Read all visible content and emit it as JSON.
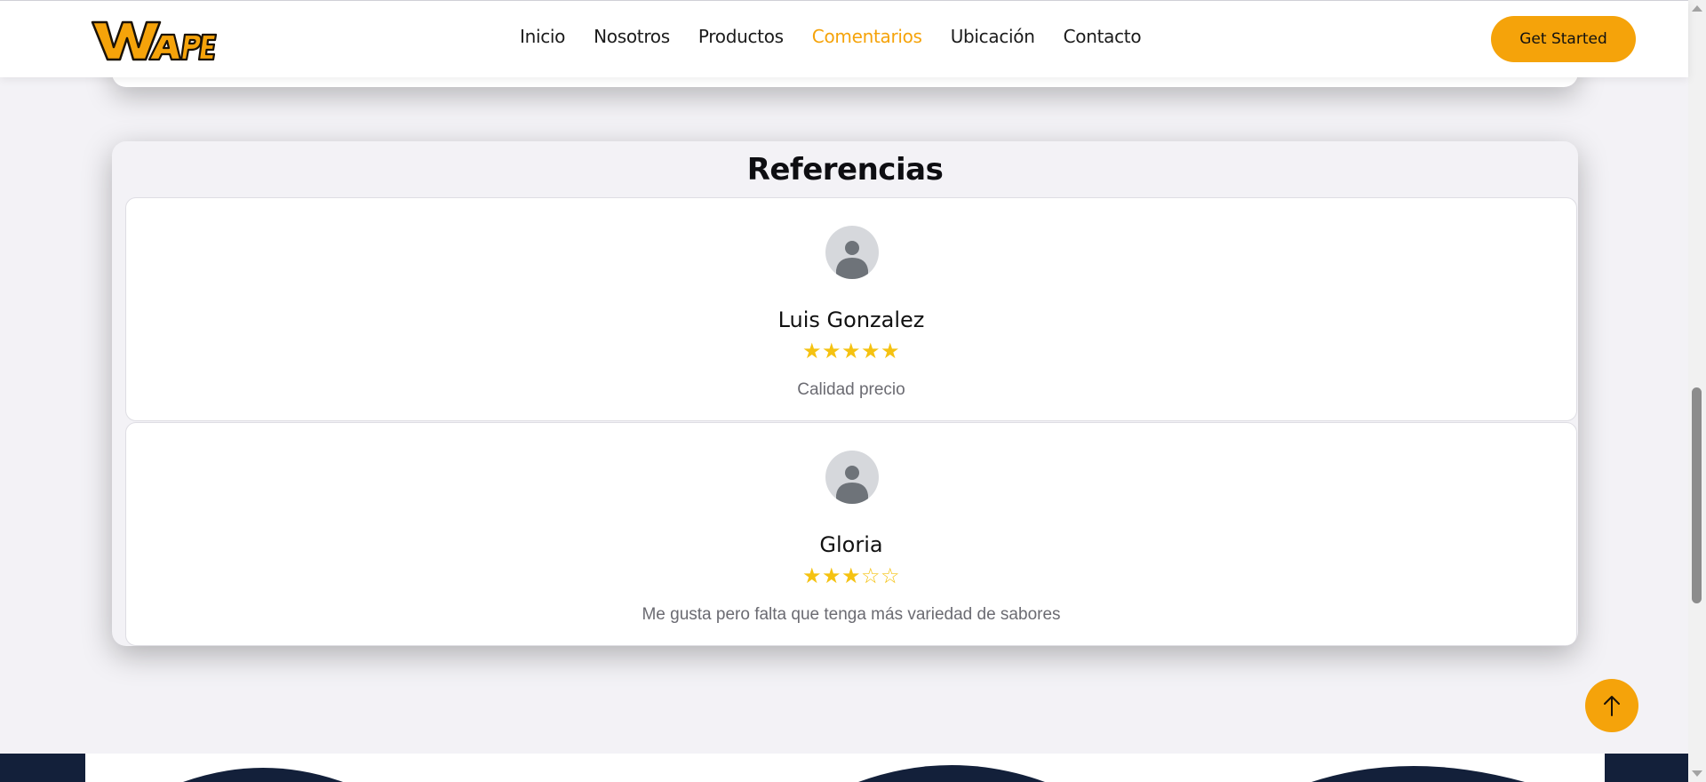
{
  "header": {
    "logo_text": "WAPE",
    "nav": [
      "Inicio",
      "Nosotros",
      "Productos",
      "Comentarios",
      "Ubicación",
      "Contacto"
    ],
    "active_nav": "Comentarios",
    "cta_label": "Get Started"
  },
  "references": {
    "title": "Referencias",
    "reviews": [
      {
        "name": "Luis Gonzalez",
        "rating": 5,
        "max_rating": 5,
        "comment": "Calidad precio"
      },
      {
        "name": "Gloria",
        "rating": 3,
        "max_rating": 5,
        "comment": "Me gusta pero falta que tenga más variedad de sabores"
      }
    ]
  },
  "colors": {
    "accent": "#f5a30a",
    "star": "#f5c211",
    "footer": "#13203a"
  },
  "icons": {
    "scroll_top": "arrow-up-icon",
    "avatar": "user-avatar-icon"
  }
}
